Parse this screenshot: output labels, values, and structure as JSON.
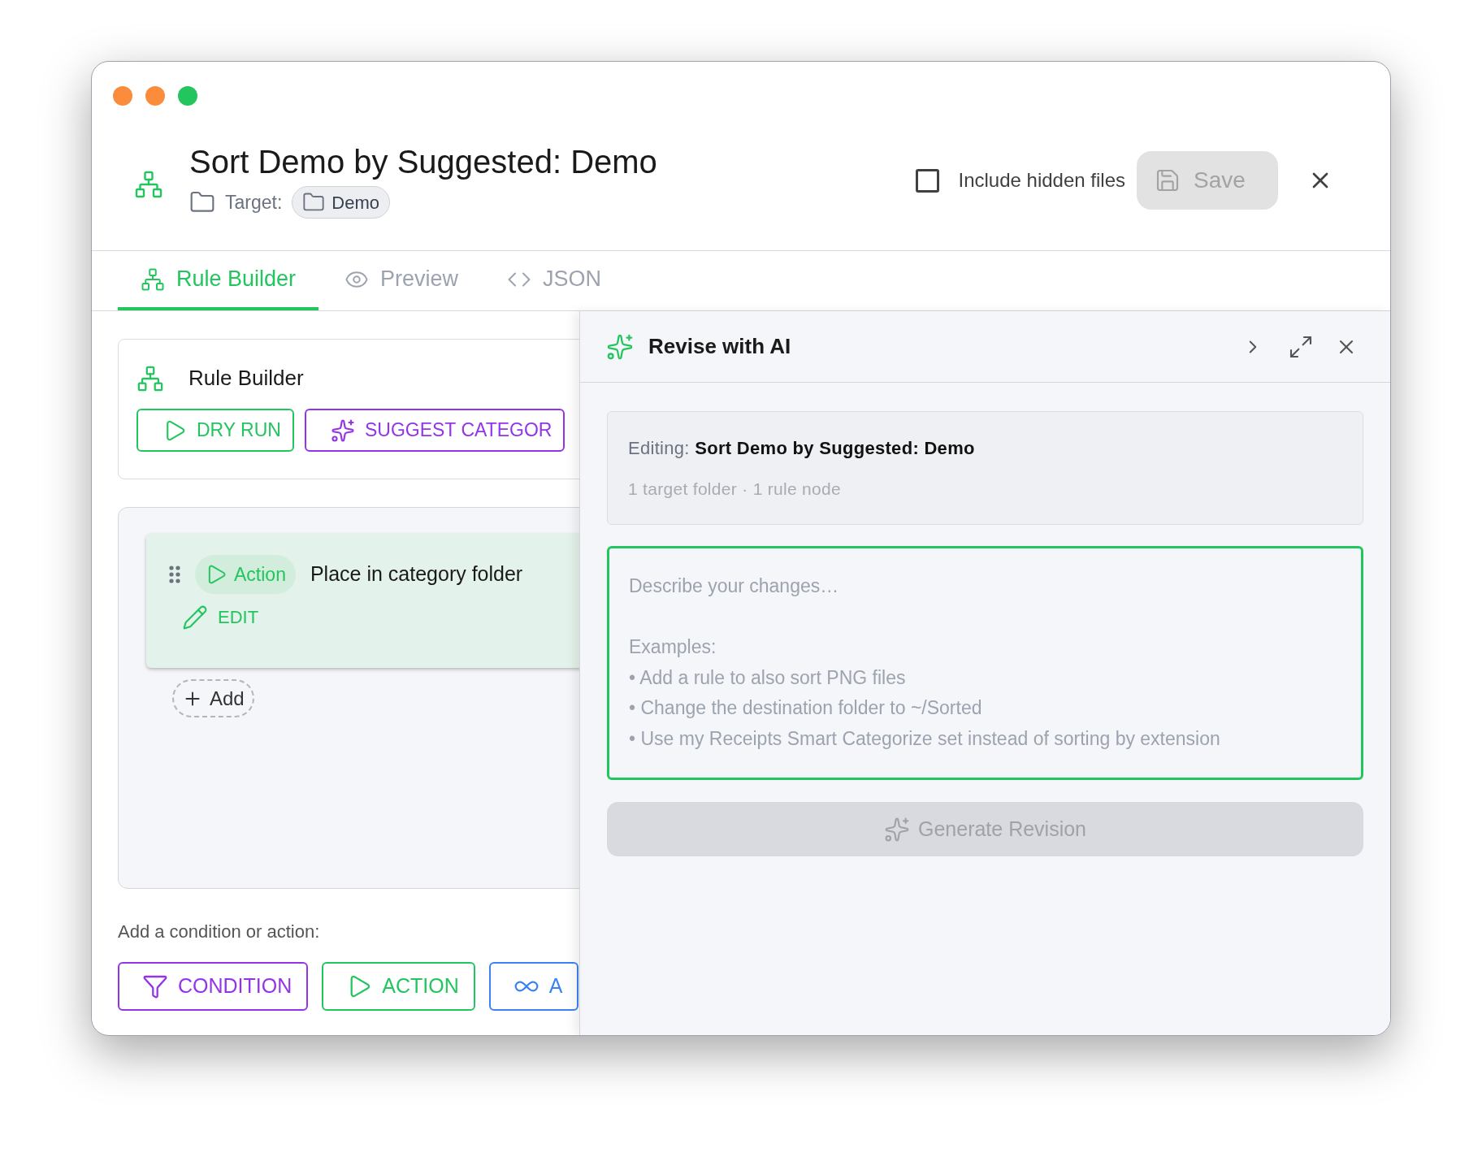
{
  "header": {
    "title": "Sort Demo by Suggested: Demo",
    "target_label": "Target:",
    "target_folder": "Demo",
    "include_hidden": {
      "label": "Include hidden files",
      "checked": false
    },
    "save_button": {
      "label": "Save",
      "disabled": true
    }
  },
  "tabs": [
    {
      "label": "Rule Builder",
      "selected": true
    },
    {
      "label": "Preview",
      "selected": false
    },
    {
      "label": "JSON",
      "selected": false
    }
  ],
  "rule_builder": {
    "title": "Rule Builder",
    "buttons": [
      {
        "label": "DRY RUN",
        "kind": "run"
      },
      {
        "label": "SUGGEST CATEGOR",
        "kind": "suggest"
      }
    ]
  },
  "rule_nodes": [
    {
      "kind": "action",
      "badge": "Action",
      "text": "Place in category folder",
      "edit": "EDIT"
    }
  ],
  "add_button": "Add",
  "add_section": {
    "label": "Add a condition or action:",
    "buttons": [
      {
        "label": "CONDITION",
        "kind": "condition"
      },
      {
        "label": "ACTION",
        "kind": "action"
      },
      {
        "label": "A",
        "kind": "loop"
      }
    ]
  },
  "ai_panel": {
    "title": "Revise with AI",
    "editing": "Editing: **Sort Demo by Suggested: Demo**",
    "summary": "1 target folder · 1 rule node",
    "prompt": {
      "placeholder": "Describe your changes…\n\nExamples:\n• Add a rule to also sort PNG files\n• Change the destination folder to ~/Sorted\n• Use my Receipts Smart Categorize set instead of sorting by extension",
      "focused": true
    },
    "generate_button": {
      "label": "Generate Revision",
      "disabled": true
    }
  }
}
